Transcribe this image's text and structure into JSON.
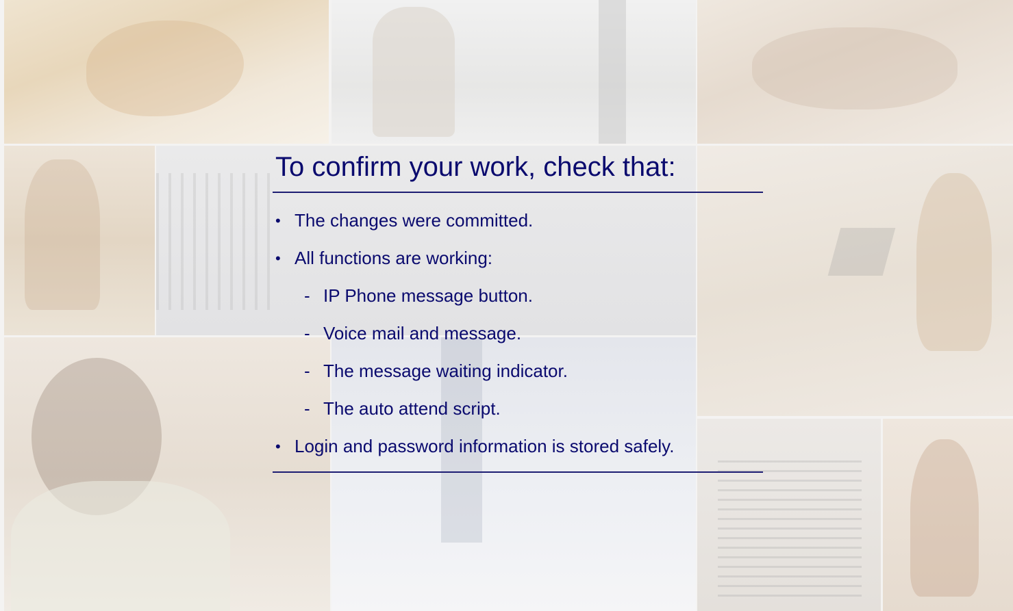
{
  "slide": {
    "heading": "To confirm your work, check that:",
    "items": [
      {
        "level": 1,
        "marker": "•",
        "text": "The changes were committed."
      },
      {
        "level": 1,
        "marker": "•",
        "text": "All functions are working:"
      },
      {
        "level": 2,
        "marker": "-",
        "text": "IP Phone message button."
      },
      {
        "level": 2,
        "marker": "-",
        "text": "Voice mail and message."
      },
      {
        "level": 2,
        "marker": "-",
        "text": "The message waiting indicator."
      },
      {
        "level": 2,
        "marker": "-",
        "text": "The auto attend script."
      },
      {
        "level": 1,
        "marker": "•",
        "text": "Login and password information is stored safely."
      }
    ]
  },
  "colors": {
    "text": "#0a0a6e",
    "rule": "#1c1c72",
    "banner": "#1a78b4"
  }
}
